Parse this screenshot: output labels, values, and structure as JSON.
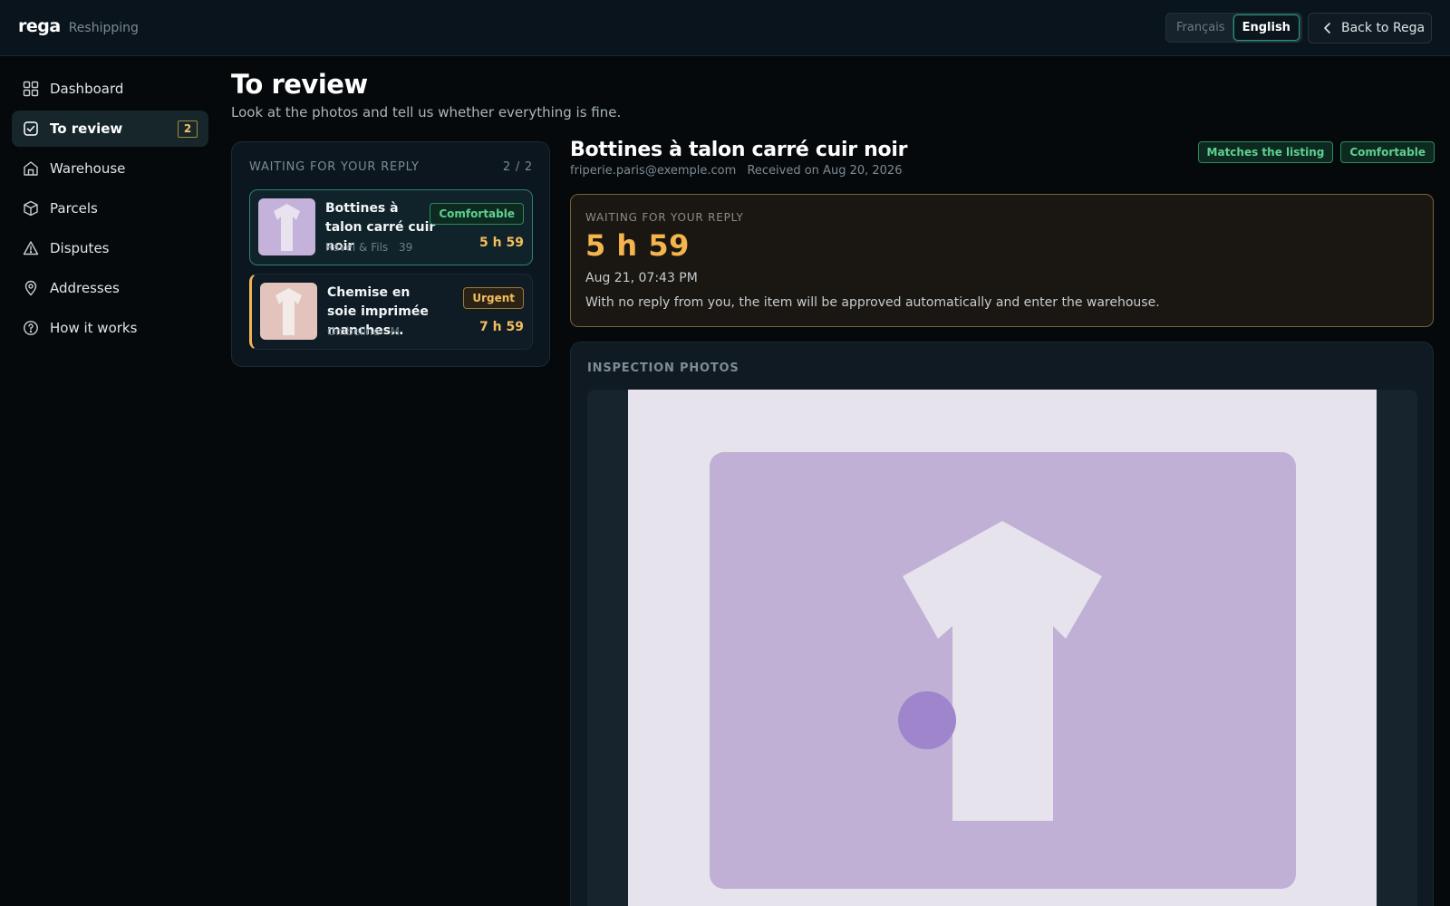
{
  "app": {
    "logo": "rega",
    "section": "Reshipping",
    "languages": [
      "Français",
      "English"
    ],
    "active_language": "English",
    "back_label": "Back to Rega"
  },
  "sidebar": {
    "items": [
      {
        "label": "Dashboard",
        "icon": "dashboard-icon"
      },
      {
        "label": "To review",
        "icon": "review-icon",
        "badge": "2",
        "active": true
      },
      {
        "label": "Warehouse",
        "icon": "warehouse-icon"
      },
      {
        "label": "Parcels",
        "icon": "parcel-icon"
      },
      {
        "label": "Disputes",
        "icon": "warning-icon"
      },
      {
        "label": "Addresses",
        "icon": "pin-icon"
      },
      {
        "label": "How it works",
        "icon": "help-icon"
      }
    ]
  },
  "page": {
    "title": "To review",
    "subtitle": "Look at the photos and tell us whether everything is fine."
  },
  "queue": {
    "heading": "WAITING FOR YOUR REPLY",
    "count": "2 / 2",
    "items": [
      {
        "title": "Bottines à talon carré cuir noir",
        "seller": "Ravel & Fils",
        "size": "39",
        "tag": "Comfortable",
        "time": "5 h 59",
        "thumb_color": "#c4b2db"
      },
      {
        "title": "Chemise en soie imprimée manches…",
        "seller": "Ombeline",
        "size": "M",
        "tag": "Urgent",
        "time": "7 h 59",
        "thumb_color": "#e3c4bd"
      }
    ]
  },
  "detail": {
    "title": "Bottines à talon carré cuir noir",
    "email": "friperie.paris@exemple.com",
    "received": "Received on Aug 20, 2026",
    "tags": [
      "Matches the listing",
      "Comfortable"
    ],
    "deadline": {
      "label": "WAITING FOR YOUR REPLY",
      "time": "5 h 59",
      "date": "Aug 21, 07:43 PM",
      "note": "With no reply from you, the item will be approved automatically and enter the warehouse."
    },
    "photos_label": "INSPECTION PHOTOS"
  },
  "colors": {
    "accent_teal": "#2f7f73",
    "amber": "#f5b54d",
    "green": "#5fd08e",
    "photo_bg": "#e6e3ec",
    "photo_card": "#c0b0d6",
    "photo_dot": "#9f86cc"
  }
}
